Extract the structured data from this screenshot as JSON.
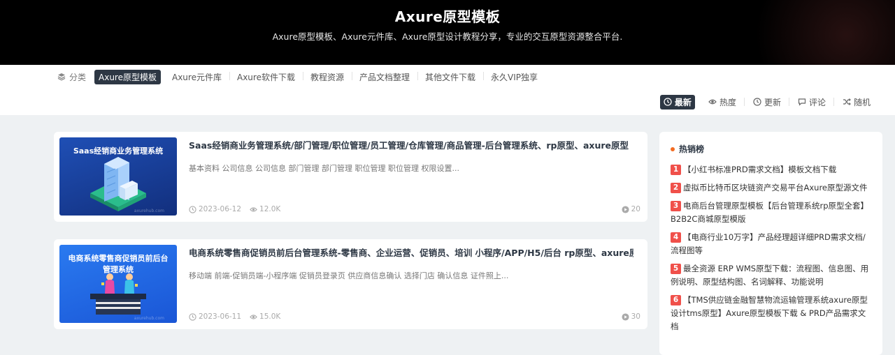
{
  "header": {
    "title": "Axure原型模板",
    "subtitle": "Axure原型模板、Axure元件库、Axure原型设计教程分享，专业的交互原型资源整合平台."
  },
  "categories": {
    "label": "分类",
    "items": [
      "Axure原型模板",
      "Axure元件库",
      "Axure软件下载",
      "教程资源",
      "产品文档整理",
      "其他文件下载",
      "永久VIP独享"
    ]
  },
  "sort": {
    "items": [
      "最新",
      "热度",
      "更新",
      "评论",
      "随机"
    ]
  },
  "posts": [
    {
      "thumb_title": "Saas经销商业务管理系统",
      "thumb_watermark": "axurehub.com",
      "title": "Saas经销商业务管理系统/部门管理/职位管理/员工管理/仓库管理/商品管理-后台管理系统、rp原型、axure原型",
      "excerpt": "基本资料 公司信息 公司信息 部门管理 部门管理 职位管理 职位管理 权限设置...",
      "date": "2023-06-12",
      "views": "12.0K",
      "comments": "20"
    },
    {
      "thumb_title": "电商系统零售商促销员前后台管理系统",
      "thumb_watermark": "axurehub.com",
      "title": "电商系统零售商促销员前后台管理系统-零售商、企业运营、促销员、培训 小程序/APP/H5/后台 rp原型、axure原型",
      "excerpt": "移动端 前端-促销员端-小程序端 促销员登录页 供应商信息确认 选择门店 确认信息 证件照上...",
      "date": "2023-06-11",
      "views": "15.0K",
      "comments": "30"
    }
  ],
  "sidebar": {
    "title": "热销榜",
    "items": [
      {
        "rank": "1",
        "text": "【小红书标准PRD需求文档】模板文档下载"
      },
      {
        "rank": "2",
        "text": "虚拟币比特币区块链资产交易平台Axure原型源文件"
      },
      {
        "rank": "3",
        "text": "电商后台管理原型模板【后台管理系统rp原型全套】B2B2C商城原型模版"
      },
      {
        "rank": "4",
        "text": "【电商行业10万字】产品经理超详细PRD需求文档/流程图等"
      },
      {
        "rank": "5",
        "text": "最全资源 ERP WMS原型下载：流程图、信息图、用例说明、原型结构图、名词解释、功能说明"
      },
      {
        "rank": "6",
        "text": "【TMS供应链金融智慧物流运输管理系统axure原型设计tms原型】Axure原型模板下载 & PRD产品需求文档"
      }
    ]
  },
  "colors": {
    "header_bg": "#000000",
    "active_tab": "#2d3744",
    "rank_badge": "#f0504a",
    "hot_dot": "#f36c22",
    "page_bg": "#eef1f3"
  }
}
